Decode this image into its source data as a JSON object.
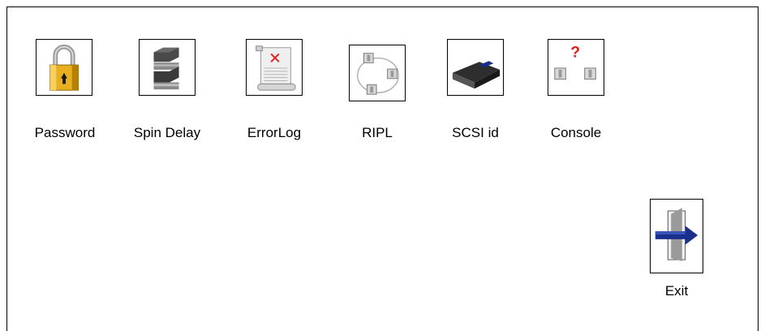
{
  "menu": {
    "items": [
      {
        "id": "password",
        "label": "Password",
        "icon": "padlock-icon"
      },
      {
        "id": "spin-delay",
        "label": "Spin Delay",
        "icon": "disk-stack-icon"
      },
      {
        "id": "errorlog",
        "label": "ErrorLog",
        "icon": "scroll-error-icon"
      },
      {
        "id": "ripl",
        "label": "RIPL",
        "icon": "network-nodes-icon"
      },
      {
        "id": "scsi-id",
        "label": "SCSI id",
        "icon": "scsi-drive-icon"
      },
      {
        "id": "console",
        "label": "Console",
        "icon": "console-question-icon"
      }
    ]
  },
  "exit": {
    "label": "Exit",
    "icon": "exit-door-icon"
  },
  "colors": {
    "lock_gold": "#e8b020",
    "arrow_blue": "#1a2f8c",
    "error_red": "#e02020"
  }
}
